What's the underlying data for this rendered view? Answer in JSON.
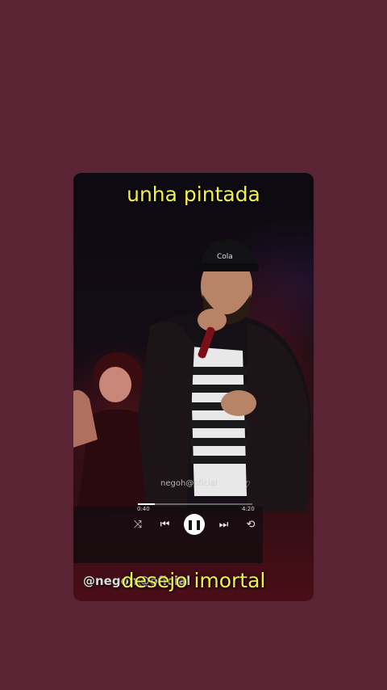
{
  "lyrics": {
    "top": "unha pintada",
    "bottom": "desejo imortal"
  },
  "watermark": "@negoh@oficial",
  "player": {
    "handle": "negoh@oficial",
    "time_elapsed": "0:40",
    "time_total": "4:20",
    "progress": 0.15,
    "icons": {
      "shuffle": "shuffle-icon",
      "previous": "skip-previous-icon",
      "play_pause": "pause-icon",
      "next": "skip-next-icon",
      "repeat": "repeat-icon",
      "like": "heart-icon"
    }
  },
  "colors": {
    "background": "#5a2434",
    "lyric": "#f4f04a"
  }
}
